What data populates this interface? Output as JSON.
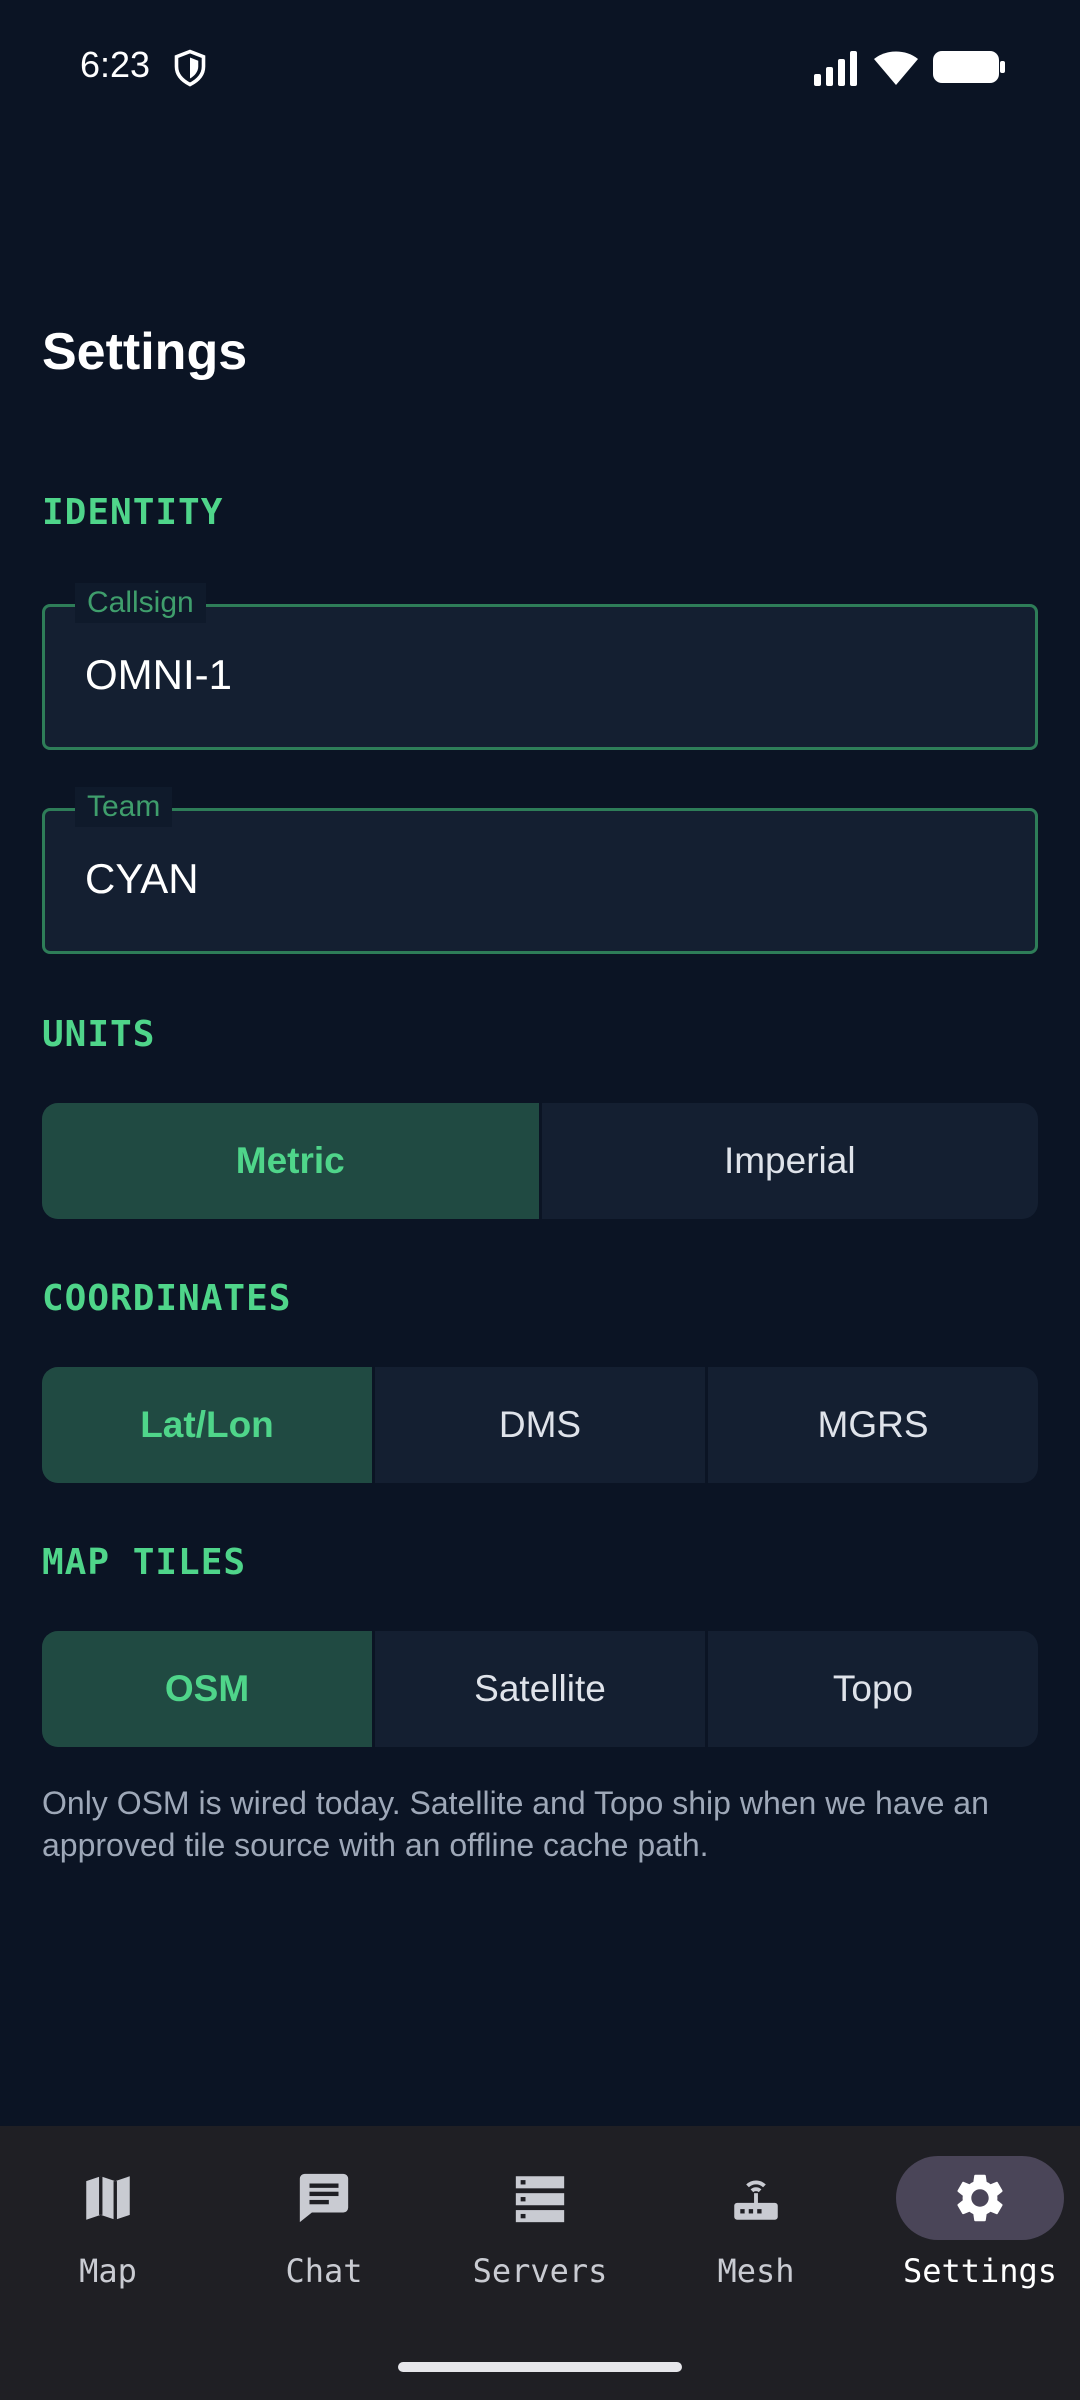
{
  "status_bar": {
    "time": "6:23",
    "icons": [
      "shield-icon",
      "signal-icon",
      "wifi-icon",
      "battery-icon"
    ]
  },
  "page": {
    "title": "Settings"
  },
  "identity": {
    "section_label": "IDENTITY",
    "callsign": {
      "label": "Callsign",
      "value": "OMNI-1"
    },
    "team": {
      "label": "Team",
      "value": "CYAN"
    }
  },
  "units": {
    "section_label": "UNITS",
    "options": [
      "Metric",
      "Imperial"
    ],
    "selected": "Metric"
  },
  "coordinates": {
    "section_label": "COORDINATES",
    "options": [
      "Lat/Lon",
      "DMS",
      "MGRS"
    ],
    "selected": "Lat/Lon"
  },
  "map_tiles": {
    "section_label": "MAP TILES",
    "options": [
      "OSM",
      "Satellite",
      "Topo"
    ],
    "selected": "OSM",
    "helper_text": "Only OSM is wired today. Satellite and Topo ship when we have an approved tile source with an offline cache path."
  },
  "nav": {
    "items": [
      {
        "label": "Map",
        "icon": "map-icon"
      },
      {
        "label": "Chat",
        "icon": "chat-icon"
      },
      {
        "label": "Servers",
        "icon": "servers-icon"
      },
      {
        "label": "Mesh",
        "icon": "router-icon"
      },
      {
        "label": "Settings",
        "icon": "gear-icon"
      }
    ],
    "active": "Settings"
  },
  "colors": {
    "background": "#0b1424",
    "accent": "#4fd58a",
    "selected_segment": "#204a42",
    "field_border": "#2e7d58",
    "nav_background": "#1f1f24"
  }
}
